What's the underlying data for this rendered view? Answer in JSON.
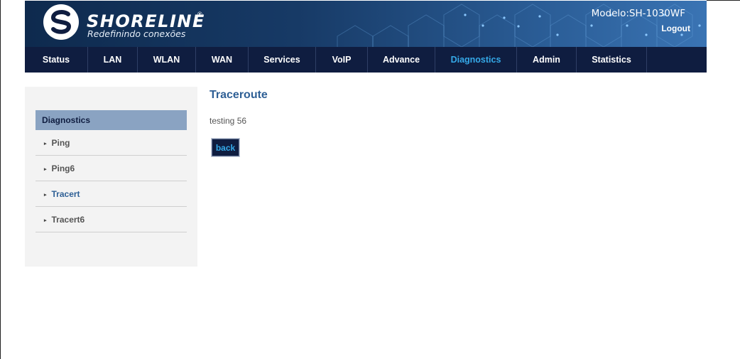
{
  "header": {
    "brand": "SHORELINE",
    "tagline": "Redefinindo conexões",
    "model": "Modelo:SH-1030WF",
    "logout_label": "Logout"
  },
  "nav": {
    "items": [
      {
        "label": "Status"
      },
      {
        "label": "LAN"
      },
      {
        "label": "WLAN"
      },
      {
        "label": "WAN"
      },
      {
        "label": "Services"
      },
      {
        "label": "VoIP"
      },
      {
        "label": "Advance"
      },
      {
        "label": "Diagnostics",
        "active": true
      },
      {
        "label": "Admin"
      },
      {
        "label": "Statistics"
      }
    ]
  },
  "sidebar": {
    "heading": "Diagnostics",
    "items": [
      {
        "label": "Ping"
      },
      {
        "label": "Ping6"
      },
      {
        "label": "Tracert",
        "active": true
      },
      {
        "label": "Tracert6"
      }
    ]
  },
  "main": {
    "title": "Traceroute",
    "status": "testing 56",
    "back_label": "back"
  },
  "colors": {
    "nav_bg": "#0f1d40",
    "accent": "#35a9e8",
    "title": "#2e5f95",
    "sidebar_head": "#8aa3c2"
  }
}
